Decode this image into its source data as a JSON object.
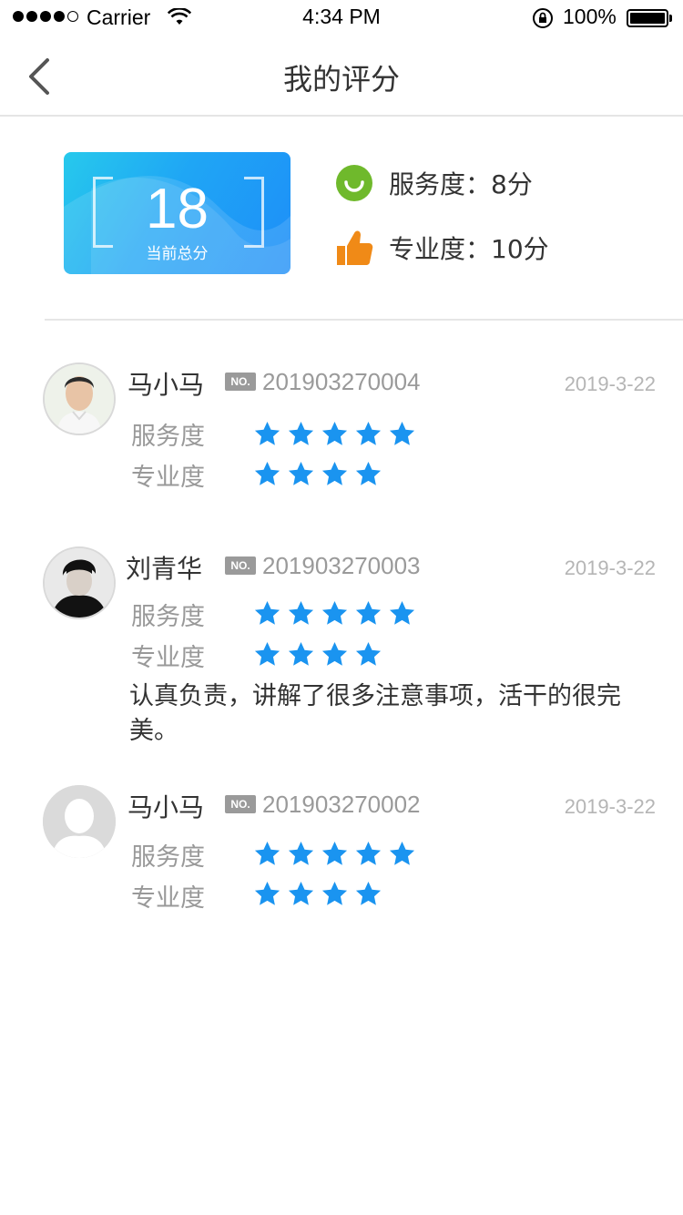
{
  "status_bar": {
    "carrier": "Carrier",
    "time": "4:34 PM",
    "battery": "100%"
  },
  "nav": {
    "title": "我的评分"
  },
  "summary": {
    "total_score": "18",
    "total_label": "当前总分",
    "service_text": "服务度：8分",
    "professional_text": "专业度：10分",
    "colors": {
      "card": "#1fa6f5",
      "service_icon": "#6fb92c",
      "professional_icon": "#f08a17"
    }
  },
  "reviews": [
    {
      "name": "马小马",
      "badge": "NO.",
      "number": "201903270004",
      "date": "2019-3-22",
      "service_label": "服务度",
      "service_stars": 5,
      "professional_label": "专业度",
      "professional_stars": 4,
      "comment": ""
    },
    {
      "name": "刘青华",
      "badge": "NO.",
      "number": "201903270003",
      "date": "2019-3-22",
      "service_label": "服务度",
      "service_stars": 5,
      "professional_label": "专业度",
      "professional_stars": 4,
      "comment": "认真负责，讲解了很多注意事项，活干的很完美。"
    },
    {
      "name": "马小马",
      "badge": "NO.",
      "number": "201903270002",
      "date": "2019-3-22",
      "service_label": "服务度",
      "service_stars": 5,
      "professional_label": "专业度",
      "professional_stars": 4,
      "comment": ""
    }
  ],
  "star_color": "#1a94f0"
}
